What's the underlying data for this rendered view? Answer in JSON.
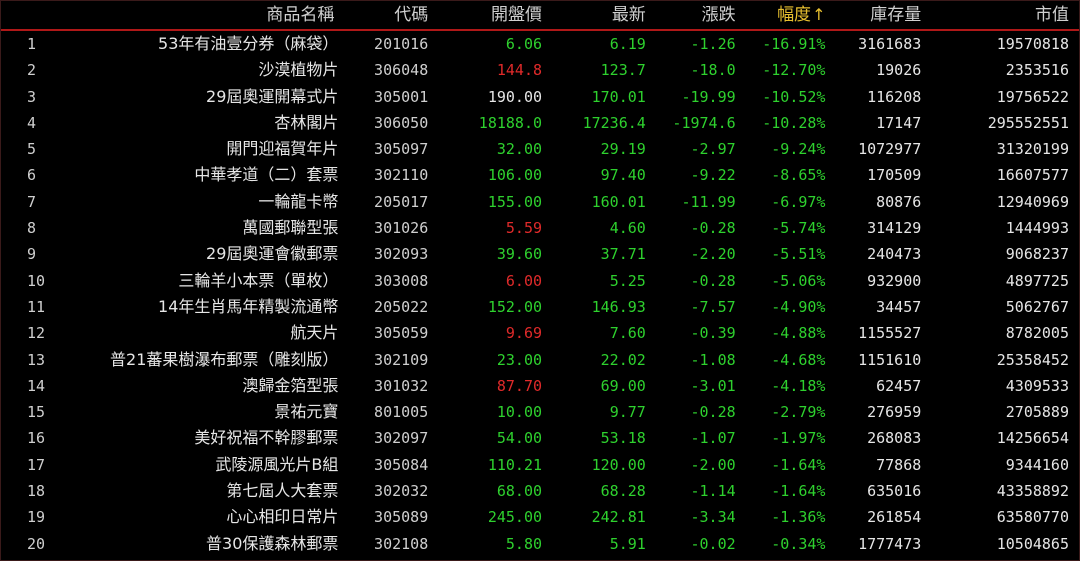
{
  "colors": {
    "up": "#e02a2a",
    "down": "#2ed12e",
    "flat": "#e6e6e6",
    "sort_header": "#e8c030",
    "header_rule": "#b01818"
  },
  "header": {
    "name": "商品名稱",
    "code": "代碼",
    "open": "開盤價",
    "last": "最新",
    "change": "漲跌",
    "pct": "幅度",
    "pct_sort_icon": "arrow-up-icon",
    "stock": "庫存量",
    "mcap": "市值"
  },
  "rows": [
    {
      "idx": "1",
      "name": "53年有油壹分券（麻袋）",
      "code": "201016",
      "open": "6.06",
      "open_dir": "down",
      "last": "6.19",
      "change": "-1.26",
      "pct": "-16.91%",
      "stock": "3161683",
      "mcap": "19570818"
    },
    {
      "idx": "2",
      "name": "沙漠植物片",
      "code": "306048",
      "open": "144.8",
      "open_dir": "up",
      "last": "123.7",
      "change": "-18.0",
      "pct": "-12.70%",
      "stock": "19026",
      "mcap": "2353516"
    },
    {
      "idx": "3",
      "name": "29屆奧運開幕式片",
      "code": "305001",
      "open": "190.00",
      "open_dir": "flat",
      "last": "170.01",
      "change": "-19.99",
      "pct": "-10.52%",
      "stock": "116208",
      "mcap": "19756522"
    },
    {
      "idx": "4",
      "name": "杏林閣片",
      "code": "306050",
      "open": "18188.0",
      "open_dir": "down",
      "last": "17236.4",
      "change": "-1974.6",
      "pct": "-10.28%",
      "stock": "17147",
      "mcap": "295552551"
    },
    {
      "idx": "5",
      "name": "開門迎福賀年片",
      "code": "305097",
      "open": "32.00",
      "open_dir": "down",
      "last": "29.19",
      "change": "-2.97",
      "pct": "-9.24%",
      "stock": "1072977",
      "mcap": "31320199"
    },
    {
      "idx": "6",
      "name": "中華孝道（二）套票",
      "code": "302110",
      "open": "106.00",
      "open_dir": "down",
      "last": "97.40",
      "change": "-9.22",
      "pct": "-8.65%",
      "stock": "170509",
      "mcap": "16607577"
    },
    {
      "idx": "7",
      "name": "一輪龍卡幣",
      "code": "205017",
      "open": "155.00",
      "open_dir": "down",
      "last": "160.01",
      "change": "-11.99",
      "pct": "-6.97%",
      "stock": "80876",
      "mcap": "12940969"
    },
    {
      "idx": "8",
      "name": "萬國郵聯型張",
      "code": "301026",
      "open": "5.59",
      "open_dir": "up",
      "last": "4.60",
      "change": "-0.28",
      "pct": "-5.74%",
      "stock": "314129",
      "mcap": "1444993"
    },
    {
      "idx": "9",
      "name": "29屆奧運會徽郵票",
      "code": "302093",
      "open": "39.60",
      "open_dir": "down",
      "last": "37.71",
      "change": "-2.20",
      "pct": "-5.51%",
      "stock": "240473",
      "mcap": "9068237"
    },
    {
      "idx": "10",
      "name": "三輪羊小本票（單枚）",
      "code": "303008",
      "open": "6.00",
      "open_dir": "up",
      "last": "5.25",
      "change": "-0.28",
      "pct": "-5.06%",
      "stock": "932900",
      "mcap": "4897725"
    },
    {
      "idx": "11",
      "name": "14年生肖馬年精製流通幣",
      "code": "205022",
      "open": "152.00",
      "open_dir": "down",
      "last": "146.93",
      "change": "-7.57",
      "pct": "-4.90%",
      "stock": "34457",
      "mcap": "5062767"
    },
    {
      "idx": "12",
      "name": "航天片",
      "code": "305059",
      "open": "9.69",
      "open_dir": "up",
      "last": "7.60",
      "change": "-0.39",
      "pct": "-4.88%",
      "stock": "1155527",
      "mcap": "8782005"
    },
    {
      "idx": "13",
      "name": "普21蕃果樹瀑布郵票（雕刻版）",
      "code": "302109",
      "open": "23.00",
      "open_dir": "down",
      "last": "22.02",
      "change": "-1.08",
      "pct": "-4.68%",
      "stock": "1151610",
      "mcap": "25358452"
    },
    {
      "idx": "14",
      "name": "澳歸金箔型張",
      "code": "301032",
      "open": "87.70",
      "open_dir": "up",
      "last": "69.00",
      "change": "-3.01",
      "pct": "-4.18%",
      "stock": "62457",
      "mcap": "4309533"
    },
    {
      "idx": "15",
      "name": "景祐元寶",
      "code": "801005",
      "open": "10.00",
      "open_dir": "down",
      "last": "9.77",
      "change": "-0.28",
      "pct": "-2.79%",
      "stock": "276959",
      "mcap": "2705889"
    },
    {
      "idx": "16",
      "name": "美好祝福不幹膠郵票",
      "code": "302097",
      "open": "54.00",
      "open_dir": "down",
      "last": "53.18",
      "change": "-1.07",
      "pct": "-1.97%",
      "stock": "268083",
      "mcap": "14256654"
    },
    {
      "idx": "17",
      "name": "武陵源風光片B組",
      "code": "305084",
      "open": "110.21",
      "open_dir": "down",
      "last": "120.00",
      "change": "-2.00",
      "pct": "-1.64%",
      "stock": "77868",
      "mcap": "9344160"
    },
    {
      "idx": "18",
      "name": "第七屆人大套票",
      "code": "302032",
      "open": "68.00",
      "open_dir": "down",
      "last": "68.28",
      "change": "-1.14",
      "pct": "-1.64%",
      "stock": "635016",
      "mcap": "43358892"
    },
    {
      "idx": "19",
      "name": "心心相印日常片",
      "code": "305089",
      "open": "245.00",
      "open_dir": "down",
      "last": "242.81",
      "change": "-3.34",
      "pct": "-1.36%",
      "stock": "261854",
      "mcap": "63580770"
    },
    {
      "idx": "20",
      "name": "普30保護森林郵票",
      "code": "302108",
      "open": "5.80",
      "open_dir": "down",
      "last": "5.91",
      "change": "-0.02",
      "pct": "-0.34%",
      "stock": "1777473",
      "mcap": "10504865"
    }
  ]
}
